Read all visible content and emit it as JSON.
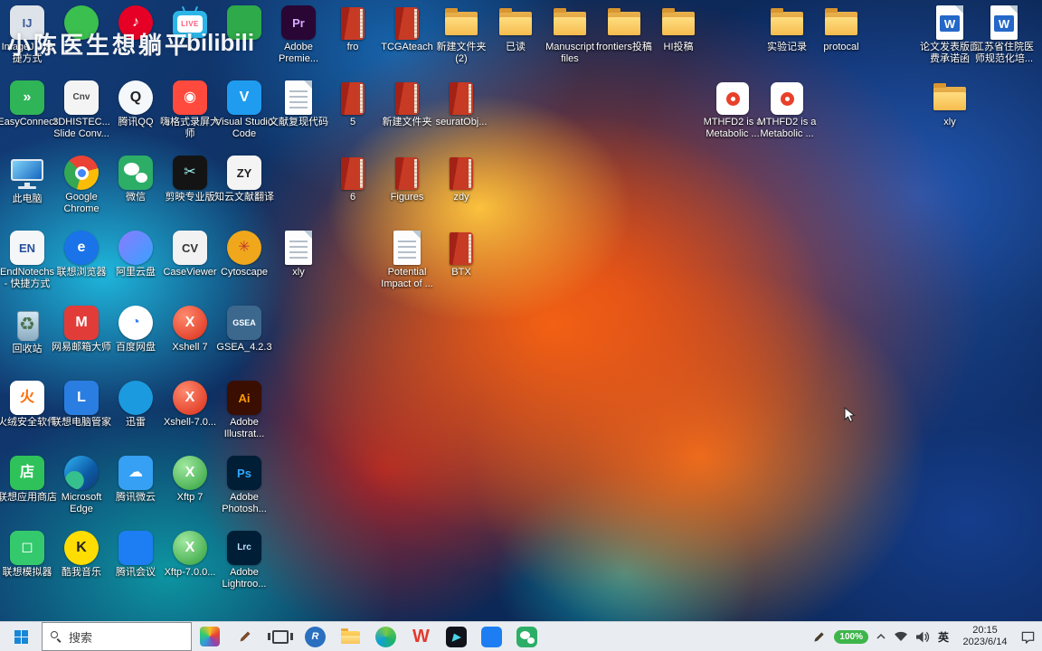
{
  "watermark": {
    "uploader": "小陈医生想躺平",
    "bilibili": "bilibili"
  },
  "colors": {
    "taskbar_bg": "#e9edf1",
    "battery_green": "#3db54a",
    "folder_yellow": "#f5bc4f",
    "wallpaper_orange": "#f66212",
    "wallpaper_blue": "#123c78",
    "wallpaper_cyan": "#20c4e8"
  },
  "desktop": {
    "icons": [
      {
        "name": "imagej",
        "label": "ImageJ - 快捷方式",
        "shape": "app",
        "bg": "#dde3e9",
        "fg": "#3a5a98",
        "glyph": "IJ",
        "col": 0,
        "row": 0
      },
      {
        "name": "easyconnect",
        "label": "EasyConnect",
        "shape": "app",
        "bg": "#2fb457",
        "fg": "#ffffff",
        "glyph": "»",
        "col": 0,
        "row": 1
      },
      {
        "name": "this-pc",
        "label": "此电脑",
        "shape": "pc",
        "col": 0,
        "row": 2
      },
      {
        "name": "endnote",
        "label": "EndNotechs - 快捷方式",
        "shape": "app",
        "bg": "#f4f6f8",
        "fg": "#274f9e",
        "glyph": "EN",
        "col": 0,
        "row": 3
      },
      {
        "name": "recycle-bin",
        "label": "回收站",
        "shape": "recycle",
        "glyph": "♻",
        "col": 0,
        "row": 4
      },
      {
        "name": "huorong-security",
        "label": "火绒安全软件",
        "shape": "app",
        "bg": "#ffffff",
        "fg": "#ff6a00",
        "glyph": "火",
        "col": 0,
        "row": 5
      },
      {
        "name": "lenovo-app-store",
        "label": "联想应用商店",
        "shape": "app",
        "bg": "#2fc25b",
        "fg": "#ffffff",
        "glyph": "店",
        "col": 0,
        "row": 6
      },
      {
        "name": "lenovo-emulator",
        "label": "联想模拟器",
        "shape": "app",
        "bg": "#35c96d",
        "fg": "#ffffff",
        "glyph": "◻",
        "col": 0,
        "row": 7
      },
      {
        "name": "green-circle-app",
        "label": "",
        "shape": "circle",
        "bg": "#3bbf4e",
        "fg": "#ffffff",
        "glyph": "",
        "col": 1,
        "row": 0
      },
      {
        "name": "slide-converter",
        "label": "3DHISTEC... Slide Conv...",
        "shape": "app",
        "bg": "#f4f4f4",
        "fg": "#444444",
        "glyph": "Cnv",
        "col": 1,
        "row": 1
      },
      {
        "name": "google-chrome",
        "label": "Google Chrome",
        "shape": "chrome",
        "col": 1,
        "row": 2
      },
      {
        "name": "lenovo-browser",
        "label": "联想浏览器",
        "shape": "circle",
        "bg": "#1a73e8",
        "fg": "#ffffff",
        "glyph": "e",
        "col": 1,
        "row": 3
      },
      {
        "name": "netease-mail",
        "label": "网易邮箱大师",
        "shape": "app",
        "bg": "#e23c39",
        "fg": "#ffffff",
        "glyph": "M",
        "col": 1,
        "row": 4
      },
      {
        "name": "lenovo-pc-manager",
        "label": "联想电脑管家",
        "shape": "app",
        "bg": "#2a7de1",
        "fg": "#ffffff",
        "glyph": "L",
        "col": 1,
        "row": 5
      },
      {
        "name": "microsoft-edge",
        "label": "Microsoft Edge",
        "shape": "edge",
        "col": 1,
        "row": 6
      },
      {
        "name": "kuwo-music",
        "label": "酷我音乐",
        "shape": "circle",
        "bg": "#ffdd00",
        "fg": "#222222",
        "glyph": "K",
        "col": 1,
        "row": 7
      },
      {
        "name": "netease-cloud-music",
        "label": "",
        "shape": "circle",
        "bg": "#e60026",
        "fg": "#ffffff",
        "glyph": "♪",
        "col": 2,
        "row": 0
      },
      {
        "name": "tencent-qq",
        "label": "腾讯QQ",
        "shape": "circle",
        "bg": "#f4f8fb",
        "fg": "#222222",
        "glyph": "Q",
        "col": 2,
        "row": 1
      },
      {
        "name": "wechat",
        "label": "微信",
        "shape": "wechat",
        "col": 2,
        "row": 2
      },
      {
        "name": "aliyun-drive",
        "label": "阿里云盘",
        "shape": "circle",
        "bg": "linear-gradient(135deg,#8a7bff,#37a2ff)",
        "fg": "#ffffff",
        "glyph": "",
        "col": 2,
        "row": 3
      },
      {
        "name": "baidu-netdisk",
        "label": "百度网盘",
        "shape": "circle",
        "bg": "#ffffff",
        "fg": "#2f7cf6",
        "glyph": "◔",
        "col": 2,
        "row": 4
      },
      {
        "name": "xunlei",
        "label": "迅雷",
        "shape": "circle",
        "bg": "#1b9ae0",
        "fg": "#ffffff",
        "glyph": "",
        "col": 2,
        "row": 5
      },
      {
        "name": "tencent-weiyun",
        "label": "腾讯微云",
        "shape": "app",
        "bg": "#35a0f4",
        "fg": "#ffffff",
        "glyph": "☁",
        "col": 2,
        "row": 6
      },
      {
        "name": "tencent-meeting",
        "label": "腾讯会议",
        "shape": "app",
        "bg": "#1d7df2",
        "fg": "#ffffff",
        "glyph": "",
        "col": 2,
        "row": 7
      },
      {
        "name": "bilibili-live",
        "label": "",
        "shape": "bililive",
        "glyph": "LIVE",
        "col": 3,
        "row": 0
      },
      {
        "name": "higeshi-recorder",
        "label": "嗨格式录屏大师",
        "shape": "app",
        "bg": "#ff4a3d",
        "fg": "#ffffff",
        "glyph": "◉",
        "col": 3,
        "row": 1
      },
      {
        "name": "jianying",
        "label": "剪映专业版",
        "shape": "app",
        "bg": "#141414",
        "fg": "#9ef3ef",
        "glyph": "✂",
        "col": 3,
        "row": 2
      },
      {
        "name": "caseviewer",
        "label": "CaseViewer",
        "shape": "app",
        "bg": "#f2f2f2",
        "fg": "#333333",
        "glyph": "CV",
        "col": 3,
        "row": 3
      },
      {
        "name": "xshell-7",
        "label": "Xshell 7",
        "shape": "circle",
        "bg": "radial-gradient(circle at 35% 30%,#ff8a6e,#d92b16)",
        "fg": "#ffffff",
        "glyph": "X",
        "col": 3,
        "row": 4
      },
      {
        "name": "xshell-installer",
        "label": "Xshell-7.0...",
        "shape": "circle",
        "bg": "radial-gradient(circle at 35% 30%,#ff8a6e,#d92b16)",
        "fg": "#ffffff",
        "glyph": "X",
        "col": 3,
        "row": 5
      },
      {
        "name": "xftp-7",
        "label": "Xftp 7",
        "shape": "circle",
        "bg": "radial-gradient(circle at 35% 30%,#9fe89f,#2e9e3a)",
        "fg": "#ffffff",
        "glyph": "X",
        "col": 3,
        "row": 6
      },
      {
        "name": "xftp-installer",
        "label": "Xftp-7.0.0...",
        "shape": "circle",
        "bg": "radial-gradient(circle at 35% 30%,#9fe89f,#2e9e3a)",
        "fg": "#ffffff",
        "glyph": "X",
        "col": 3,
        "row": 7
      },
      {
        "name": "green-app-2",
        "label": "",
        "shape": "app",
        "bg": "#2faa4a",
        "fg": "#ffffff",
        "glyph": "",
        "col": 4,
        "row": 0
      },
      {
        "name": "vscode",
        "label": "Visual Studio Code",
        "shape": "app",
        "bg": "#1f9cf0",
        "fg": "#ffffff",
        "glyph": "V",
        "col": 4,
        "row": 1
      },
      {
        "name": "zhiyun-translate",
        "label": "知云文献翻译",
        "shape": "app",
        "bg": "#f4f4f4",
        "fg": "#222222",
        "glyph": "ZY",
        "col": 4,
        "row": 2
      },
      {
        "name": "cytoscape",
        "label": "Cytoscape",
        "shape": "circle",
        "bg": "#f0a71c",
        "fg": "#c0392b",
        "glyph": "✳",
        "col": 4,
        "row": 3
      },
      {
        "name": "gsea",
        "label": "GSEA_4.2.3",
        "shape": "app",
        "bg": "#3c688e",
        "fg": "#ffffff",
        "glyph": "GSEA",
        "col": 4,
        "row": 4
      },
      {
        "name": "adobe-illustrator",
        "label": "Adobe Illustrat...",
        "shape": "app",
        "bg": "#3a0e00",
        "fg": "#ff9a00",
        "glyph": "Ai",
        "col": 4,
        "row": 5
      },
      {
        "name": "adobe-photoshop",
        "label": "Adobe Photosh...",
        "shape": "app",
        "bg": "#001e36",
        "fg": "#31a8ff",
        "glyph": "Ps",
        "col": 4,
        "row": 6
      },
      {
        "name": "adobe-lightroom",
        "label": "Adobe Lightroo...",
        "shape": "app",
        "bg": "#001e36",
        "fg": "#bfe3ff",
        "glyph": "Lrc",
        "col": 4,
        "row": 7
      },
      {
        "name": "adobe-premiere",
        "label": "Adobe Premie...",
        "shape": "app",
        "bg": "#2a0634",
        "fg": "#d8a9ff",
        "glyph": "Pr",
        "col": 5,
        "row": 0
      },
      {
        "name": "wenxian-code-doc",
        "label": "文献复现代码",
        "shape": "doc",
        "col": 5,
        "row": 1
      },
      {
        "name": "xly-doc",
        "label": "xly",
        "shape": "doc",
        "col": 5,
        "row": 3
      },
      {
        "name": "fro",
        "label": "fro",
        "shape": "book",
        "col": 6,
        "row": 0
      },
      {
        "name": "book-5",
        "label": "5",
        "shape": "book",
        "col": 6,
        "row": 1
      },
      {
        "name": "book-6",
        "label": "6",
        "shape": "book",
        "col": 6,
        "row": 2
      },
      {
        "name": "tcgateach",
        "label": "TCGAteach",
        "shape": "book",
        "col": 7,
        "row": 0
      },
      {
        "name": "new-folder-file",
        "label": "新建文件夹",
        "shape": "book",
        "col": 7,
        "row": 1
      },
      {
        "name": "figures",
        "label": "Figures",
        "shape": "book",
        "col": 7,
        "row": 2
      },
      {
        "name": "potential-impact-doc",
        "label": "Potential Impact of ...",
        "shape": "doc",
        "col": 7,
        "row": 3
      },
      {
        "name": "new-folder-2",
        "label": "新建文件夹 (2)",
        "shape": "folder",
        "col": 8,
        "row": 0
      },
      {
        "name": "seuratobj",
        "label": "seuratObj...",
        "shape": "book",
        "col": 8,
        "row": 1
      },
      {
        "name": "zdy",
        "label": "zdy",
        "shape": "book",
        "col": 8,
        "row": 2
      },
      {
        "name": "btx",
        "label": "BTX",
        "shape": "book",
        "col": 8,
        "row": 3
      },
      {
        "name": "yidu-folder",
        "label": "已读",
        "shape": "folder",
        "col": 9,
        "row": 0
      },
      {
        "name": "manuscript-files-folder",
        "label": "Manuscript files",
        "shape": "folder",
        "col": 10,
        "row": 0
      },
      {
        "name": "frontiers-folder",
        "label": "frontiers投稿",
        "shape": "folder",
        "col": 11,
        "row": 0
      },
      {
        "name": "hi-folder",
        "label": "HI投稿",
        "shape": "folder",
        "col": 12,
        "row": 0
      },
      {
        "name": "mthfd2-pdf-1",
        "label": "MTHFD2 is a Metabolic ...",
        "shape": "pdf",
        "col": 13,
        "row": 1
      },
      {
        "name": "experiment-record-folder",
        "label": "实验记录",
        "shape": "folder",
        "col": 14,
        "row": 0
      },
      {
        "name": "mthfd2-pdf-2",
        "label": "MTHFD2 is a Metabolic ...",
        "shape": "pdf",
        "col": 14,
        "row": 1
      },
      {
        "name": "protocal-folder",
        "label": "protocal",
        "shape": "folder",
        "col": 15,
        "row": 0
      },
      {
        "name": "page-fee-letter-doc",
        "label": "论文发表版面费承诺函",
        "shape": "word",
        "glyph": "W",
        "col": 17,
        "row": 0
      },
      {
        "name": "xly-folder",
        "label": "xly",
        "shape": "folder",
        "col": 17,
        "row": 1
      },
      {
        "name": "jiangsu-regulation-doc",
        "label": "江苏省住院医师规范化培...",
        "shape": "word",
        "glyph": "W",
        "col": 18,
        "row": 0
      }
    ]
  },
  "taskbar": {
    "search": {
      "placeholder": "搜索"
    },
    "apps": [
      {
        "name": "colorful-docs-app",
        "kind": "colorful"
      },
      {
        "name": "ink-pen-app",
        "kind": "pen"
      },
      {
        "name": "task-view",
        "kind": "taskview"
      },
      {
        "name": "r-project",
        "kind": "circle",
        "bg": "#2a6fc0",
        "fg": "#ffffff",
        "glyph": "R"
      },
      {
        "name": "file-explorer",
        "kind": "explorer"
      },
      {
        "name": "green-swirl-app",
        "kind": "circle",
        "bg": "conic-gradient(from 120deg,#1db36b,#0fa0d8,#7ac943,#1db36b)",
        "fg": "#ffffff",
        "glyph": ""
      },
      {
        "name": "wps-office",
        "kind": "glyph",
        "fg": "#e33a2e",
        "glyph": "W"
      },
      {
        "name": "dark-video-app",
        "kind": "app",
        "bg": "#10131c",
        "fg": "#49d6e8",
        "glyph": "▶"
      },
      {
        "name": "tencent-meeting",
        "kind": "app",
        "bg": "#1d7df2",
        "fg": "#ffffff",
        "glyph": ""
      },
      {
        "name": "wechat",
        "kind": "wechat"
      }
    ],
    "tray": {
      "battery": "100%",
      "lang": "英",
      "time": "20:15",
      "date": "2023/6/14"
    }
  }
}
